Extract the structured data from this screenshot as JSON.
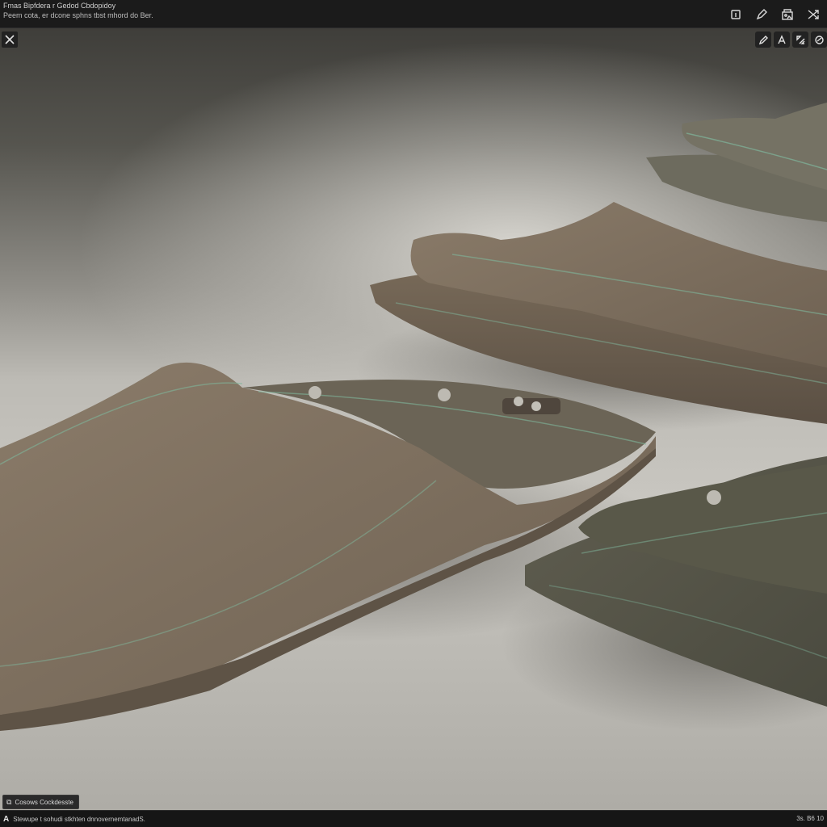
{
  "header": {
    "title": "Fmas Bipfdera r Gedod Cbdopidoy",
    "subtitle": "Peem cota, er dcone sphns tbst mhord do Ber."
  },
  "top_actions": [
    {
      "name": "frame-icon"
    },
    {
      "name": "pen-icon"
    },
    {
      "name": "gallery-icon"
    },
    {
      "name": "shuffle-icon"
    }
  ],
  "tools": [
    {
      "name": "edit-icon"
    },
    {
      "name": "text-icon"
    },
    {
      "name": "scale-icon"
    },
    {
      "name": "link-icon"
    }
  ],
  "caption": {
    "icon": "copy-icon",
    "label": "Cosows Cockdesste"
  },
  "status": {
    "logo": "A",
    "left_text": "Stewupe t sohudi stkhten dnnovernemtanadS.",
    "right_text": "3s. B6 10"
  },
  "colors": {
    "fabric_tan": "#7e6f5e",
    "fabric_olive": "#5b594c",
    "stripe": "#7fb59b",
    "button_silver": "#bdbab2"
  }
}
